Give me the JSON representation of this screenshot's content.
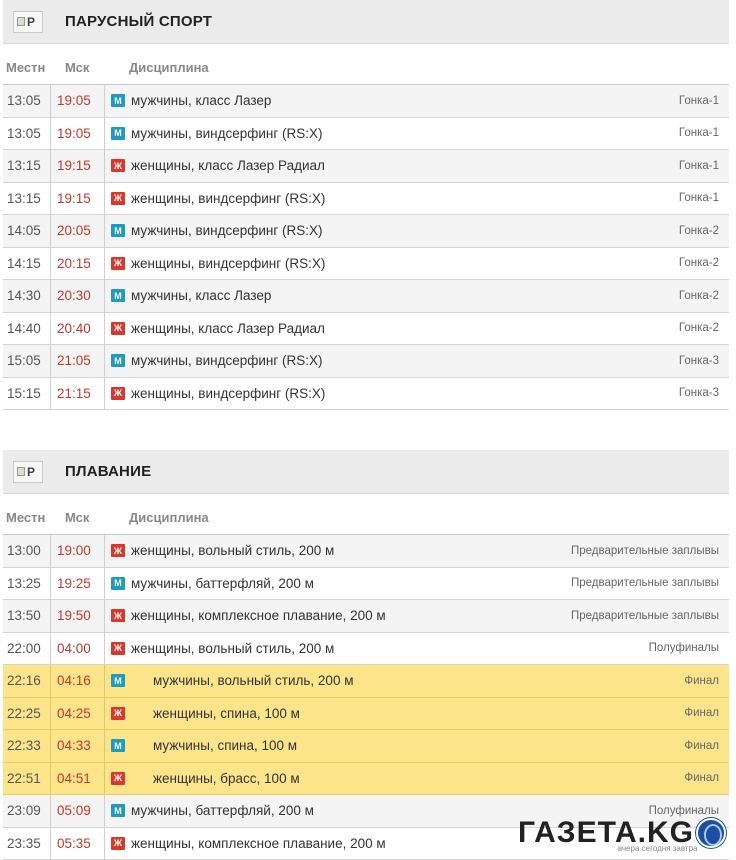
{
  "headers": {
    "local": "Местн",
    "msk": "Мск",
    "discipline": "Дисциплина"
  },
  "sections": [
    {
      "title": "ПАРУСНЫЙ СПОРТ",
      "logo_alt": "P",
      "rows": [
        {
          "local": "13:05",
          "msk": "19:05",
          "gender": "М",
          "discipline": "мужчины, класс Лазер",
          "stage": "Гонка-1"
        },
        {
          "local": "13:05",
          "msk": "19:05",
          "gender": "М",
          "discipline": "мужчины, виндсерфинг (RS:X)",
          "stage": "Гонка-1"
        },
        {
          "local": "13:15",
          "msk": "19:15",
          "gender": "Ж",
          "discipline": "женщины, класс Лазер Радиал",
          "stage": "Гонка-1"
        },
        {
          "local": "13:15",
          "msk": "19:15",
          "gender": "Ж",
          "discipline": "женщины, виндсерфинг (RS:X)",
          "stage": "Гонка-1"
        },
        {
          "local": "14:05",
          "msk": "20:05",
          "gender": "М",
          "discipline": "мужчины, виндсерфинг (RS:X)",
          "stage": "Гонка-2"
        },
        {
          "local": "14:15",
          "msk": "20:15",
          "gender": "Ж",
          "discipline": "женщины, виндсерфинг (RS:X)",
          "stage": "Гонка-2"
        },
        {
          "local": "14:30",
          "msk": "20:30",
          "gender": "М",
          "discipline": "мужчины, класс Лазер",
          "stage": "Гонка-2"
        },
        {
          "local": "14:40",
          "msk": "20:40",
          "gender": "Ж",
          "discipline": "женщины, класс Лазер Радиал",
          "stage": "Гонка-2"
        },
        {
          "local": "15:05",
          "msk": "21:05",
          "gender": "М",
          "discipline": "мужчины, виндсерфинг (RS:X)",
          "stage": "Гонка-3"
        },
        {
          "local": "15:15",
          "msk": "21:15",
          "gender": "Ж",
          "discipline": "женщины, виндсерфинг (RS:X)",
          "stage": "Гонка-3"
        }
      ]
    },
    {
      "title": "ПЛАВАНИЕ",
      "logo_alt": "P",
      "rows": [
        {
          "local": "13:00",
          "msk": "19:00",
          "gender": "Ж",
          "discipline": "женщины, вольный стиль, 200 м",
          "stage": "Предварительные заплывы"
        },
        {
          "local": "13:25",
          "msk": "19:25",
          "gender": "М",
          "discipline": "мужчины, баттерфляй, 200 м",
          "stage": "Предварительные заплывы"
        },
        {
          "local": "13:50",
          "msk": "19:50",
          "gender": "Ж",
          "discipline": "женщины, комплексное плавание, 200 м",
          "stage": "Предварительные заплывы"
        },
        {
          "local": "22:00",
          "msk": "04:00",
          "gender": "Ж",
          "discipline": "женщины, вольный стиль, 200 м",
          "stage": "Полуфиналы"
        },
        {
          "local": "22:16",
          "msk": "04:16",
          "gender": "М",
          "discipline": "мужчины, вольный стиль, 200 м",
          "stage": "Финал",
          "final": true
        },
        {
          "local": "22:25",
          "msk": "04:25",
          "gender": "Ж",
          "discipline": "женщины, спина, 100 м",
          "stage": "Финал",
          "final": true
        },
        {
          "local": "22:33",
          "msk": "04:33",
          "gender": "М",
          "discipline": "мужчины, спина, 100 м",
          "stage": "Финал",
          "final": true
        },
        {
          "local": "22:51",
          "msk": "04:51",
          "gender": "Ж",
          "discipline": "женщины, брасс, 100 м",
          "stage": "Финал",
          "final": true
        },
        {
          "local": "23:09",
          "msk": "05:09",
          "gender": "М",
          "discipline": "мужчины, баттерфляй, 200 м",
          "stage": "Полуфиналы"
        },
        {
          "local": "23:35",
          "msk": "05:35",
          "gender": "Ж",
          "discipline": "женщины, комплексное плавание, 200 м",
          "stage": ""
        }
      ]
    }
  ],
  "watermark": {
    "text": "ГАЗЕТА.KG",
    "sub": "вчера сегодня завтра"
  },
  "colors": {
    "male_badge": "#1f9bc2",
    "female_badge": "#d9382c",
    "final_row": "#fbe48a",
    "msk_time": "#c0392b"
  }
}
